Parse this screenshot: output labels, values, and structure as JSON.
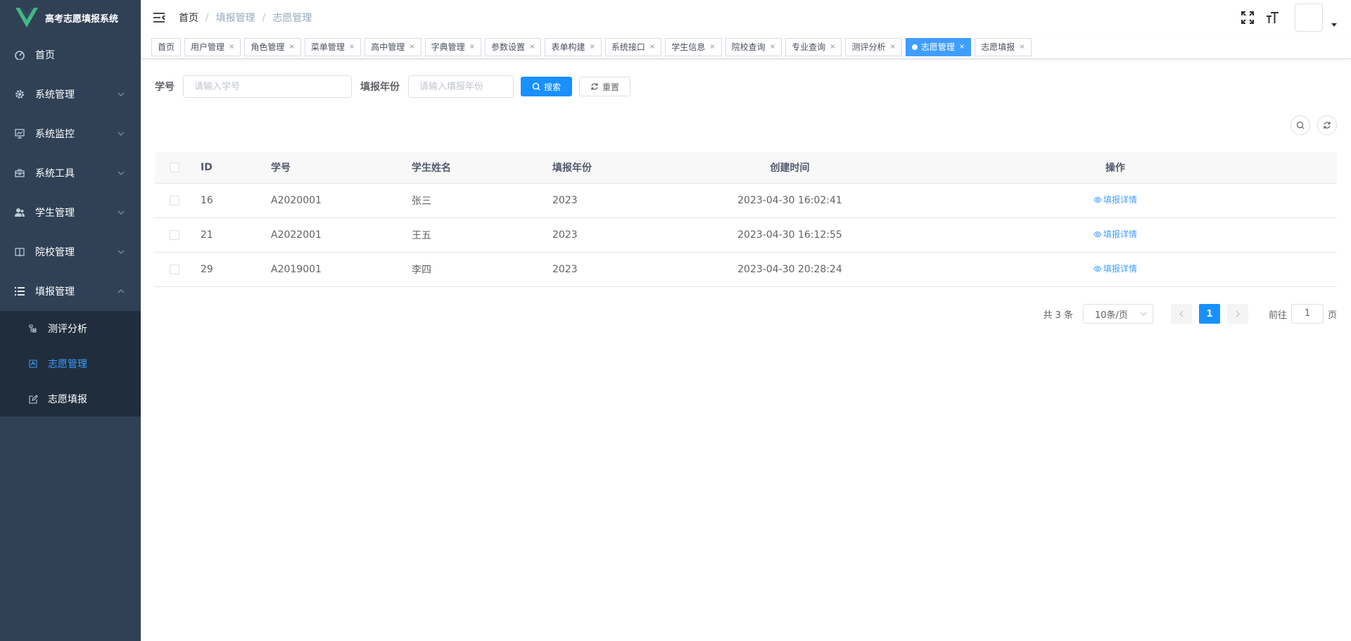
{
  "app": {
    "title": "高考志愿填报系统"
  },
  "sidebar": {
    "items": [
      {
        "label": "首页",
        "icon": "dashboard-icon"
      },
      {
        "label": "系统管理",
        "icon": "gear-icon"
      },
      {
        "label": "系统监控",
        "icon": "monitor-icon"
      },
      {
        "label": "系统工具",
        "icon": "toolbox-icon"
      },
      {
        "label": "学生管理",
        "icon": "users-icon"
      },
      {
        "label": "院校管理",
        "icon": "book-icon"
      },
      {
        "label": "填报管理",
        "icon": "list-icon"
      }
    ],
    "submenu": [
      {
        "label": "测评分析",
        "icon": "tree-icon"
      },
      {
        "label": "志愿管理",
        "icon": "form-icon",
        "active": true
      },
      {
        "label": "志愿填报",
        "icon": "edit-icon"
      }
    ]
  },
  "breadcrumb": [
    "首页",
    "填报管理",
    "志愿管理"
  ],
  "tags": [
    {
      "label": "首页"
    },
    {
      "label": "用户管理"
    },
    {
      "label": "角色管理"
    },
    {
      "label": "菜单管理"
    },
    {
      "label": "高中管理"
    },
    {
      "label": "字典管理"
    },
    {
      "label": "参数设置"
    },
    {
      "label": "表单构建"
    },
    {
      "label": "系统接口"
    },
    {
      "label": "学生信息"
    },
    {
      "label": "院校查询"
    },
    {
      "label": "专业查询"
    },
    {
      "label": "测评分析"
    },
    {
      "label": "志愿管理",
      "active": true
    },
    {
      "label": "志愿填报"
    }
  ],
  "search": {
    "student_no_label": "学号",
    "student_no_placeholder": "请输入学号",
    "year_label": "填报年份",
    "year_placeholder": "请输入填报年份",
    "search_button": "搜索",
    "reset_button": "重置"
  },
  "table": {
    "columns": [
      "ID",
      "学号",
      "学生姓名",
      "填报年份",
      "创建时间",
      "操作"
    ],
    "rows": [
      {
        "id": "16",
        "student_no": "A2020001",
        "name": "张三",
        "year": "2023",
        "created": "2023-04-30 16:02:41",
        "action": "填报详情"
      },
      {
        "id": "21",
        "student_no": "A2022001",
        "name": "王五",
        "year": "2023",
        "created": "2023-04-30 16:12:55",
        "action": "填报详情"
      },
      {
        "id": "29",
        "student_no": "A2019001",
        "name": "李四",
        "year": "2023",
        "created": "2023-04-30 20:28:24",
        "action": "填报详情"
      }
    ]
  },
  "pagination": {
    "total": "共 3 条",
    "page_size": "10条/页",
    "current_page": "1",
    "goto_label": "前往",
    "goto_value": "1",
    "page_suffix": "页"
  }
}
